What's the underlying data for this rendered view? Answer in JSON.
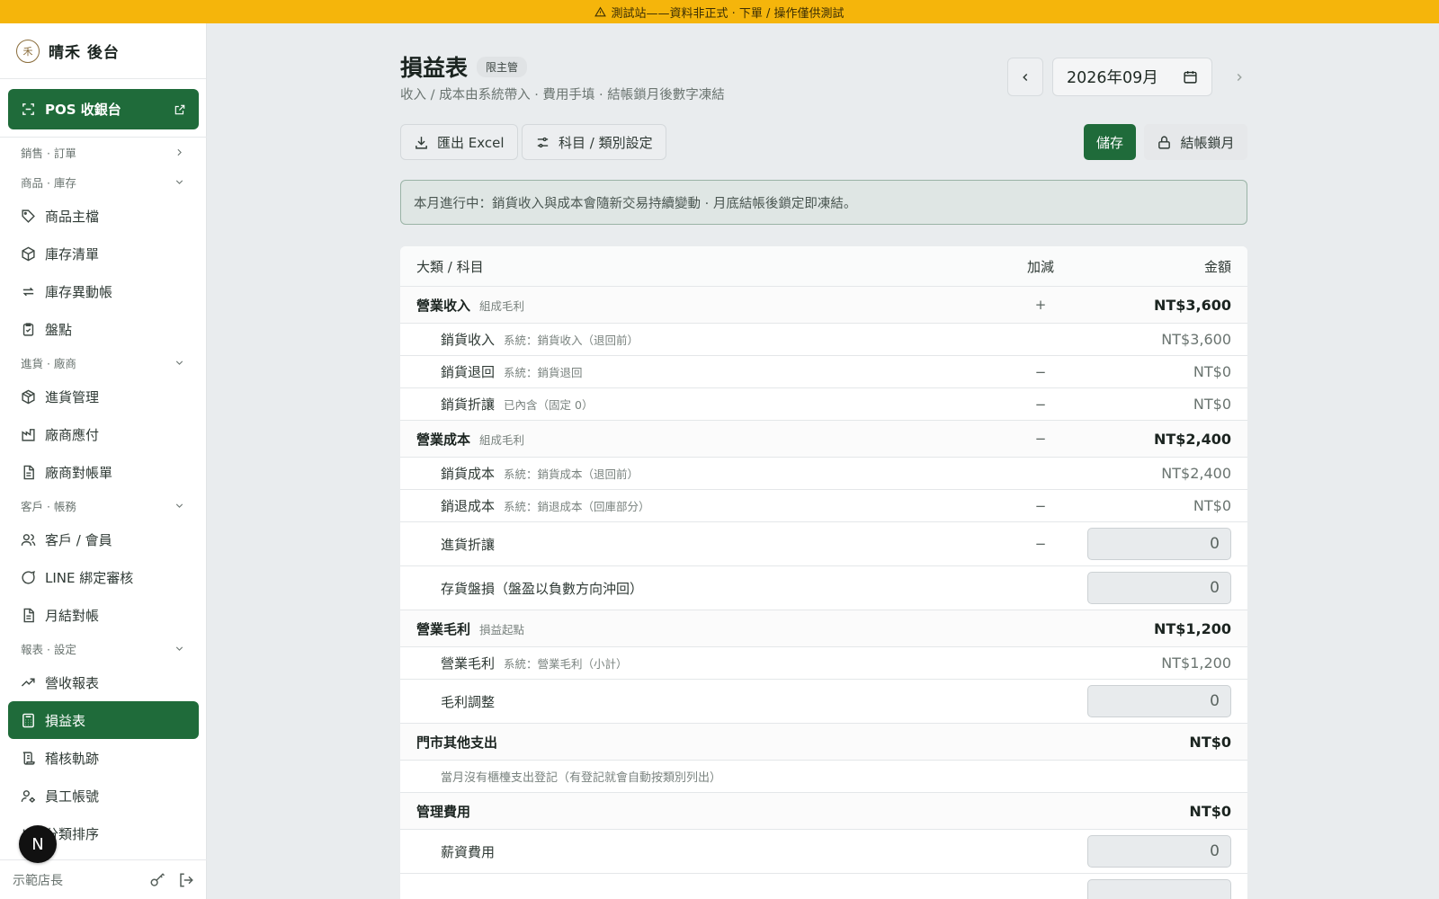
{
  "banner": {
    "text": "測試站——資料非正式 · 下單 / 操作僅供測試"
  },
  "sidebar": {
    "brand": "晴禾 後台",
    "brand_mark": "禾",
    "pos_button": "POS 收銀台",
    "sections": [
      {
        "label": "銷售 · 訂單",
        "items": []
      },
      {
        "label": "商品 · 庫存",
        "items": [
          "商品主檔",
          "庫存清單",
          "庫存異動帳",
          "盤點"
        ]
      },
      {
        "label": "進貨 · 廠商",
        "items": [
          "進貨管理",
          "廠商應付",
          "廠商對帳單"
        ]
      },
      {
        "label": "客戶 · 帳務",
        "items": [
          "客戶 / 會員",
          "LINE 綁定審核",
          "月結對帳"
        ]
      },
      {
        "label": "報表 · 設定",
        "items": [
          "營收報表",
          "損益表",
          "稽核軌跡",
          "員工帳號",
          "分類排序"
        ]
      }
    ],
    "active_item": "損益表",
    "user": "示範店長",
    "n_badge": "N"
  },
  "header": {
    "title": "損益表",
    "role_badge": "限主管",
    "subtitle": "收入 / 成本由系統帶入 · 費用手填 · 結帳鎖月後數字凍結",
    "month": "2026年09月"
  },
  "toolbar": {
    "export": "匯出 Excel",
    "settings": "科目 / 類別設定",
    "save": "儲存",
    "lock": "結帳鎖月"
  },
  "notice": "本月進行中：銷貨收入與成本會隨新交易持續變動 · 月底結帳後鎖定即凍結。",
  "table": {
    "headers": {
      "name": "大類 / 科目",
      "sign": "加減",
      "amount": "金額"
    },
    "rows": [
      {
        "type": "group",
        "name": "營業收入",
        "hint": "組成毛利",
        "sign": "+",
        "amount": "NT$3,600"
      },
      {
        "type": "sub",
        "name": "銷貨收入",
        "hint": "系統：銷貨收入（退回前）",
        "sign": "",
        "amount": "NT$3,600"
      },
      {
        "type": "sub",
        "name": "銷貨退回",
        "hint": "系統：銷貨退回",
        "sign": "−",
        "amount": "NT$0"
      },
      {
        "type": "sub",
        "name": "銷貨折讓",
        "hint": "已內含（固定 0）",
        "sign": "−",
        "amount": "NT$0"
      },
      {
        "type": "group",
        "name": "營業成本",
        "hint": "組成毛利",
        "sign": "−",
        "amount": "NT$2,400"
      },
      {
        "type": "sub",
        "name": "銷貨成本",
        "hint": "系統：銷貨成本（退回前）",
        "sign": "",
        "amount": "NT$2,400"
      },
      {
        "type": "sub",
        "name": "銷退成本",
        "hint": "系統：銷退成本（回庫部分）",
        "sign": "−",
        "amount": "NT$0"
      },
      {
        "type": "inp",
        "name": "進貨折讓",
        "hint": "",
        "sign": "−",
        "amount": "0"
      },
      {
        "type": "inp",
        "name": "存貨盤損（盤盈以負數方向沖回）",
        "hint": "",
        "sign": "",
        "amount": "0"
      },
      {
        "type": "group",
        "name": "營業毛利",
        "hint": "損益起點",
        "sign": "",
        "amount": "NT$1,200"
      },
      {
        "type": "sub",
        "name": "營業毛利",
        "hint": "系統：營業毛利（小計）",
        "sign": "",
        "amount": "NT$1,200"
      },
      {
        "type": "inp",
        "name": "毛利調整",
        "hint": "",
        "sign": "",
        "amount": "0"
      },
      {
        "type": "group",
        "name": "門市其他支出",
        "hint": "",
        "sign": "",
        "amount": "NT$0"
      },
      {
        "type": "note",
        "name": "當月沒有櫃檯支出登記（有登記就會自動按類別列出）",
        "hint": "",
        "sign": "",
        "amount": ""
      },
      {
        "type": "group",
        "name": "管理費用",
        "hint": "",
        "sign": "",
        "amount": "NT$0"
      },
      {
        "type": "inp",
        "name": "薪資費用",
        "hint": "",
        "sign": "",
        "amount": "0"
      },
      {
        "type": "inp",
        "name": "",
        "hint": "",
        "sign": "",
        "amount": ""
      }
    ]
  }
}
